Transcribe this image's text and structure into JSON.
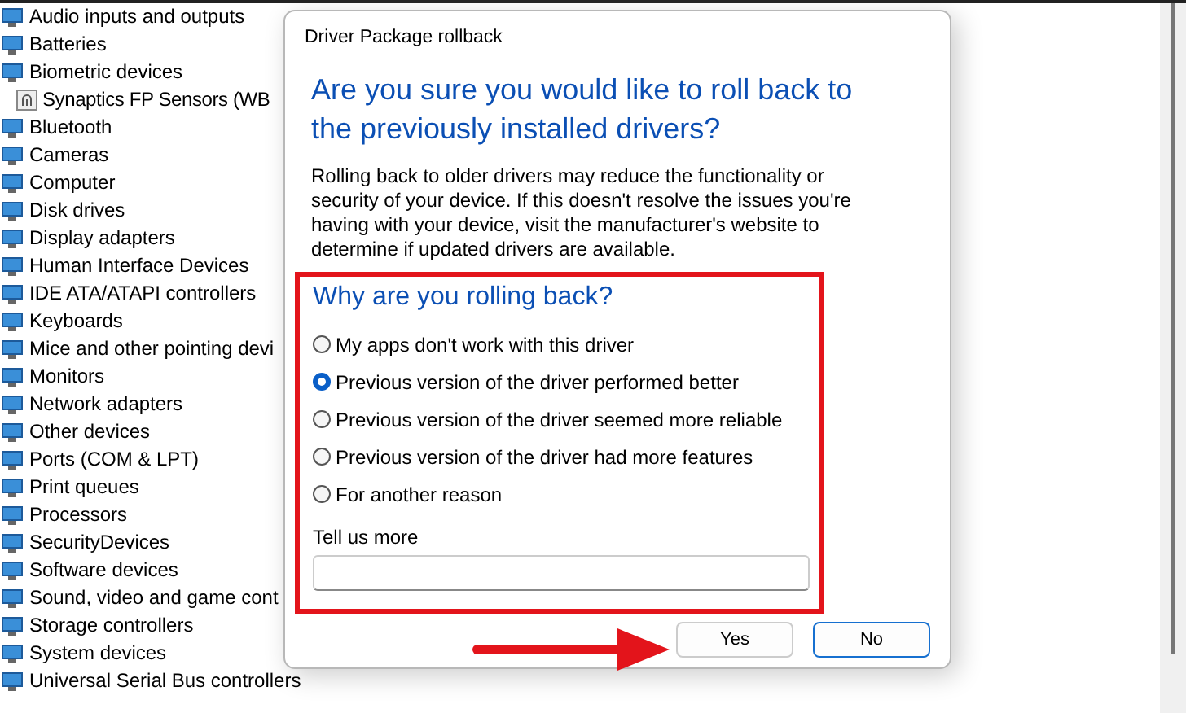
{
  "device_tree": {
    "items": [
      {
        "label": "Audio inputs and outputs"
      },
      {
        "label": "Batteries"
      },
      {
        "label": "Biometric devices",
        "children": [
          {
            "label": "Synaptics FP Sensors (WB"
          }
        ]
      },
      {
        "label": "Bluetooth"
      },
      {
        "label": "Cameras"
      },
      {
        "label": "Computer"
      },
      {
        "label": "Disk drives"
      },
      {
        "label": "Display adapters"
      },
      {
        "label": "Human Interface Devices"
      },
      {
        "label": "IDE ATA/ATAPI controllers"
      },
      {
        "label": "Keyboards"
      },
      {
        "label": "Mice and other pointing devi"
      },
      {
        "label": "Monitors"
      },
      {
        "label": "Network adapters"
      },
      {
        "label": "Other devices"
      },
      {
        "label": "Ports (COM & LPT)"
      },
      {
        "label": "Print queues"
      },
      {
        "label": "Processors"
      },
      {
        "label": "SecurityDevices"
      },
      {
        "label": "Software devices"
      },
      {
        "label": "Sound, video and game cont"
      },
      {
        "label": "Storage controllers"
      },
      {
        "label": "System devices"
      },
      {
        "label": "Universal Serial Bus controllers"
      }
    ]
  },
  "dialog": {
    "title": "Driver Package rollback",
    "heading": "Are you sure you would like to roll back to the previously installed drivers?",
    "description": "Rolling back to older drivers may reduce the functionality or security of your device.  If this doesn't resolve the issues you're having with your device, visit the manufacturer's website to determine if updated drivers are available.",
    "reasons": {
      "heading": "Why are you rolling back?",
      "options": [
        {
          "label": "My apps don't work with this driver",
          "selected": false
        },
        {
          "label": "Previous version of the driver performed better",
          "selected": true
        },
        {
          "label": "Previous version of the driver seemed more reliable",
          "selected": false
        },
        {
          "label": "Previous version of the driver had more features",
          "selected": false
        },
        {
          "label": "For another reason",
          "selected": false
        }
      ]
    },
    "more": {
      "label": "Tell us more"
    },
    "buttons": [
      "Yes",
      "No"
    ]
  }
}
